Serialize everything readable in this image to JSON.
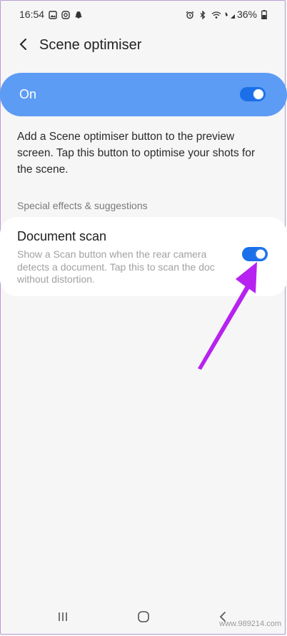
{
  "status_bar": {
    "time": "16:54",
    "battery": "36%",
    "left_icons": [
      "gallery-icon",
      "instagram-icon",
      "snapchat-icon"
    ],
    "right_icons": [
      "alarm-icon",
      "bluetooth-icon",
      "wifi-icon",
      "volte-signal-icon",
      "battery-icon"
    ]
  },
  "header": {
    "back_icon": "chevron-left-icon",
    "title": "Scene optimiser"
  },
  "master_toggle": {
    "label": "On",
    "checked": true,
    "background": "#5d9cf4",
    "switch_color": "#1b6fe8"
  },
  "description": "Add a Scene optimiser button to the preview screen. Tap this button to optimise your shots for the scene.",
  "section": {
    "header": "Special effects & suggestions",
    "items": [
      {
        "title": "Document scan",
        "summary": "Show a Scan button when the rear camera detects a document. Tap this to scan the doc without distortion.",
        "checked": true
      }
    ]
  },
  "annotation": {
    "type": "arrow",
    "color": "#b722f0",
    "points_to": "document-scan-switch"
  },
  "nav_bar": {
    "icons": [
      "recent-apps-icon",
      "home-icon",
      "back-icon"
    ]
  },
  "watermark": "www.989214.com"
}
